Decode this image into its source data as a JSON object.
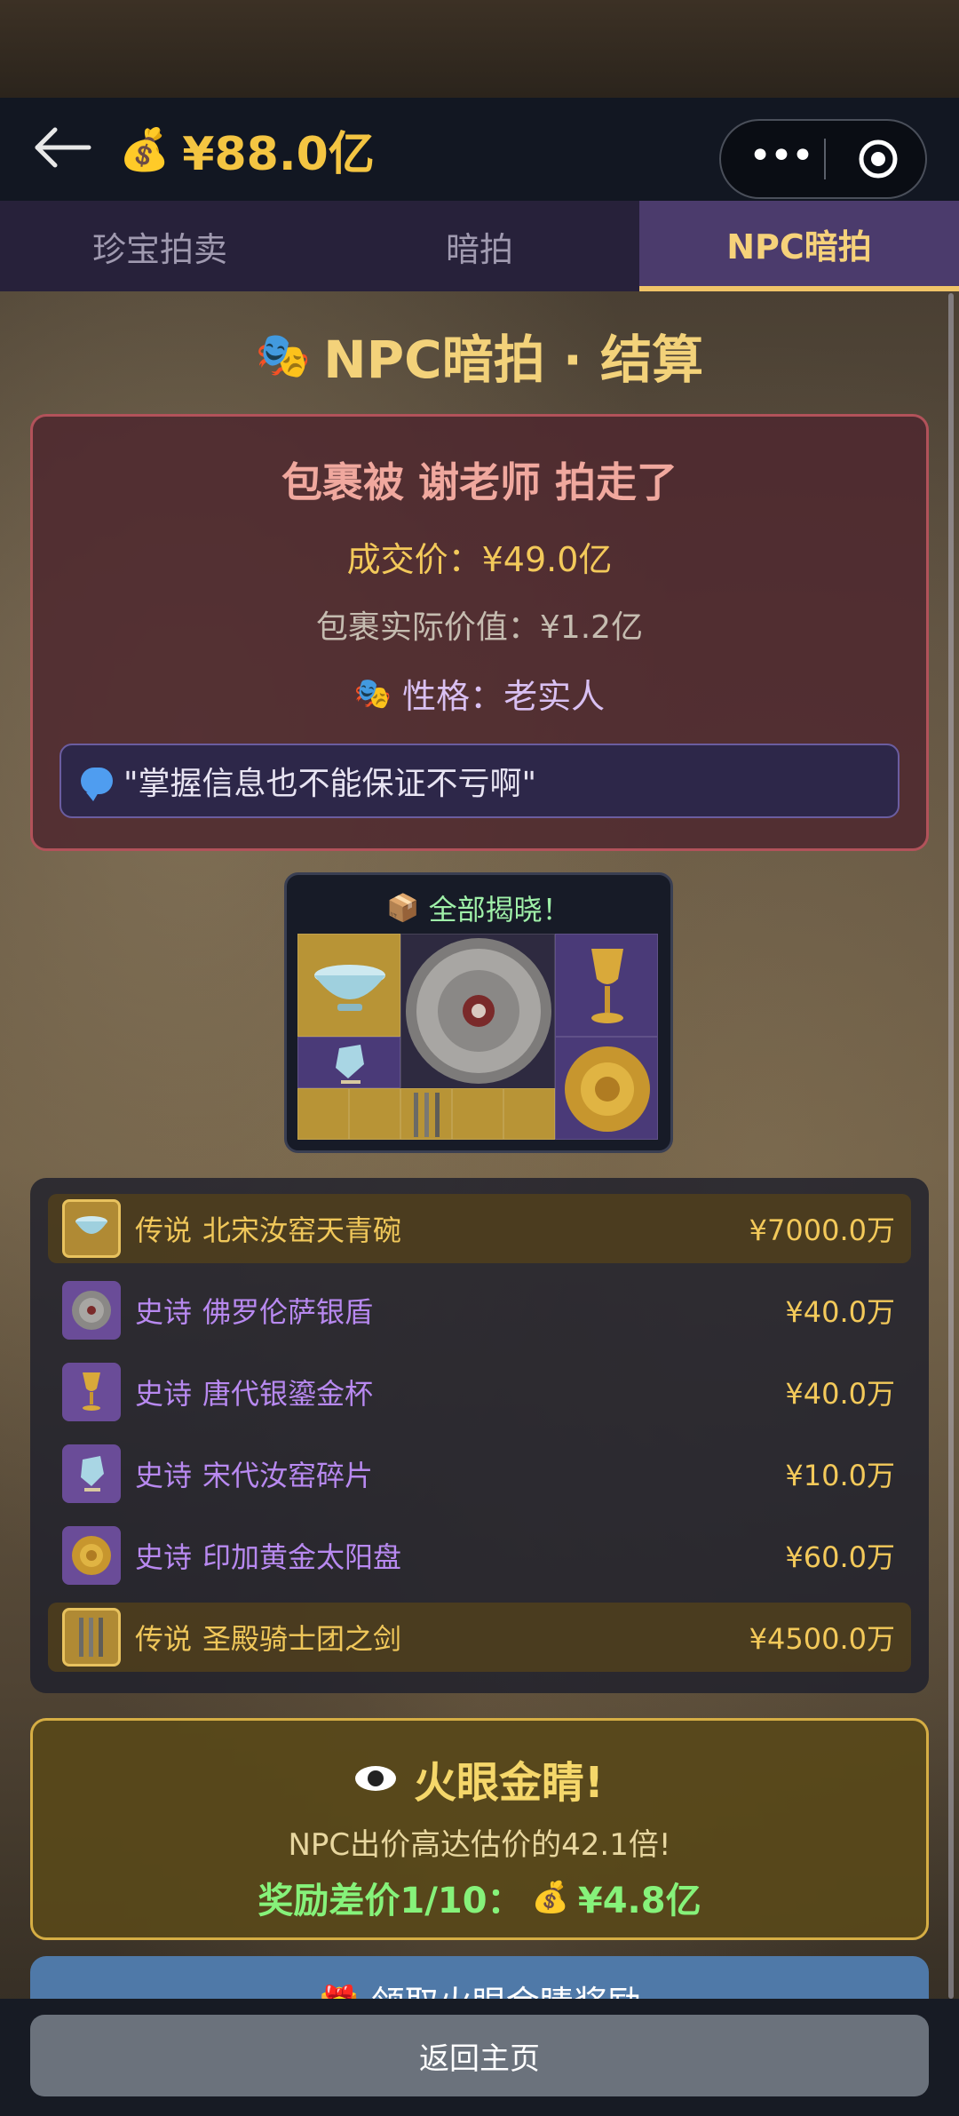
{
  "header": {
    "back_icon": "arrow-left-icon",
    "money_icon": "money-bag-icon",
    "balance": "¥88.0亿",
    "capsule_more": "•••",
    "capsule_target_icon": "target-icon"
  },
  "tabs": [
    {
      "label": "珍宝拍卖",
      "active": false
    },
    {
      "label": "暗拍",
      "active": false
    },
    {
      "label": "NPC暗拍",
      "active": true
    }
  ],
  "settlement": {
    "title": "NPC暗拍 · 结算",
    "headline": "包裹被 谢老师 拍走了",
    "deal_price": "成交价：¥49.0亿",
    "actual_value": "包裹实际价值：¥1.2亿",
    "personality": "性格：老实人",
    "quote": "\"掌握信息也不能保证不亏啊\""
  },
  "reveal": {
    "title": "全部揭晓！"
  },
  "items": [
    {
      "rarity": "传说",
      "name": "北宋汝窑天青碗",
      "price": "¥7000.0万",
      "tier": "legendary",
      "icon": "celadon-bowl-icon"
    },
    {
      "rarity": "史诗",
      "name": "佛罗伦萨银盾",
      "price": "¥40.0万",
      "tier": "epic",
      "icon": "silver-shield-icon"
    },
    {
      "rarity": "史诗",
      "name": "唐代银鎏金杯",
      "price": "¥40.0万",
      "tier": "epic",
      "icon": "gold-cup-icon"
    },
    {
      "rarity": "史诗",
      "name": "宋代汝窑碎片",
      "price": "¥10.0万",
      "tier": "epic",
      "icon": "porcelain-shard-icon"
    },
    {
      "rarity": "史诗",
      "name": "印加黄金太阳盘",
      "price": "¥60.0万",
      "tier": "epic",
      "icon": "sun-disc-icon"
    },
    {
      "rarity": "传说",
      "name": "圣殿骑士团之剑",
      "price": "¥4500.0万",
      "tier": "legendary",
      "icon": "swords-icon"
    }
  ],
  "eye": {
    "title": "火眼金睛!",
    "subtitle": "NPC出价高达估价的42.1倍!",
    "reward_label": "奖励差价1/10：",
    "reward_value": "¥4.8亿"
  },
  "claim_button": "领取火眼金睛奖励",
  "home_button": "返回主页",
  "colors": {
    "gold_text": "#f3c95a",
    "epic_purple": "#b889f0",
    "active_tab_bg": "#4b3b6c",
    "reward_green": "#86f27a"
  }
}
